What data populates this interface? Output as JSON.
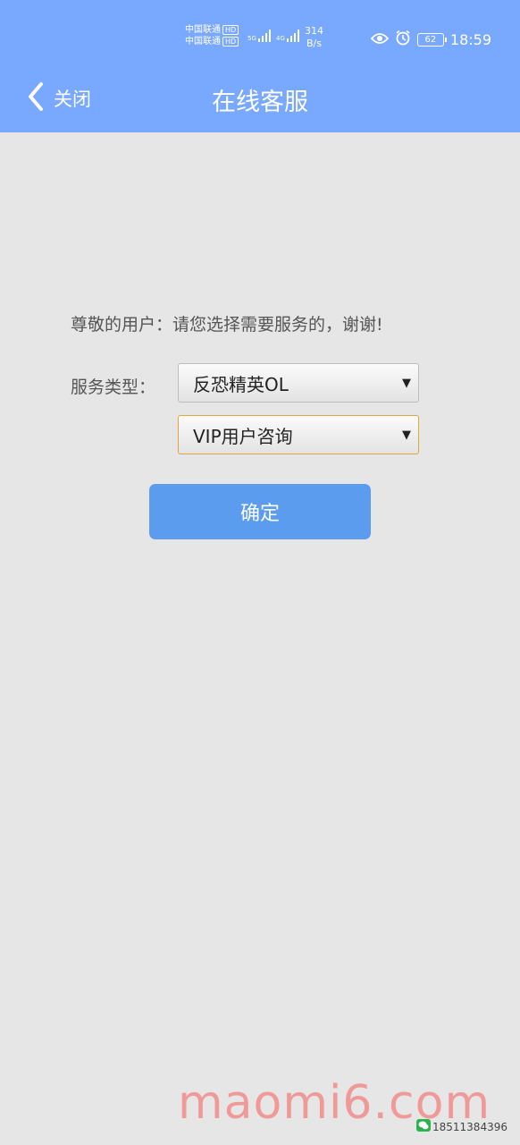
{
  "status_bar": {
    "carrier_1": "中国联通",
    "carrier_2": "中国联通",
    "hd": "HD",
    "network_1": "5G",
    "network_2": "4G",
    "speed_value": "314",
    "speed_unit": "B/s",
    "battery": "62",
    "time": "18:59"
  },
  "header": {
    "back_label": "关闭",
    "title": "在线客服"
  },
  "form": {
    "greeting": "尊敬的用户：请您选择需要服务的，谢谢!",
    "type_label": "服务类型：",
    "game_select": "反恐精英OL",
    "category_select": "VIP用户咨询",
    "confirm_label": "确定"
  },
  "watermark": {
    "text": "maomi6.com",
    "wechat_number": "18511384396"
  },
  "colors": {
    "header_bg": "#79a8ff",
    "page_bg": "#e6e6e6",
    "button_bg": "#5b9cef",
    "focus_border": "#e8a33d"
  }
}
